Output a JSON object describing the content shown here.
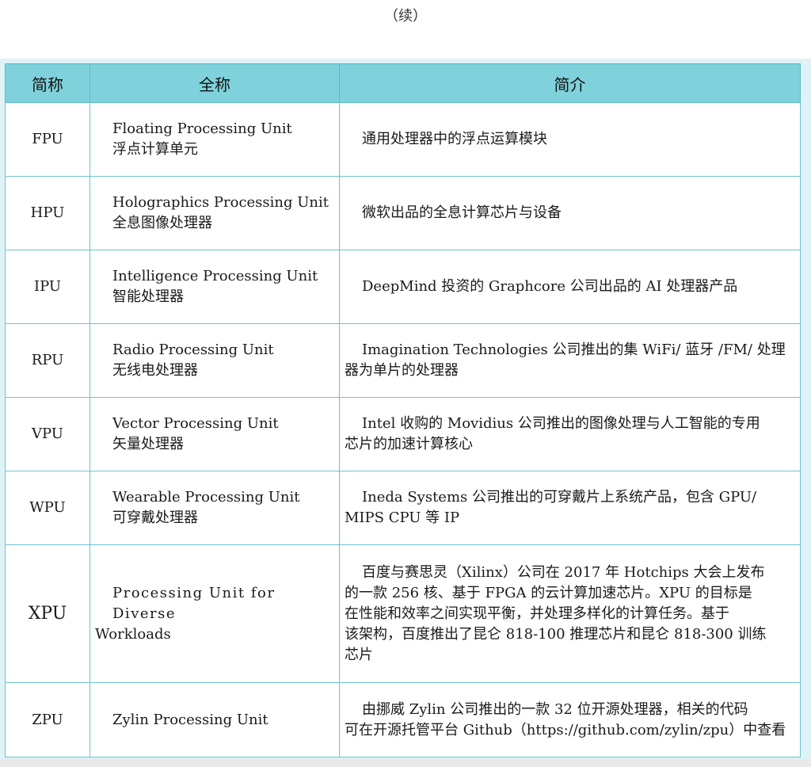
{
  "caption": "（续）",
  "table": {
    "headers": [
      "简称",
      "全称",
      "简介"
    ],
    "rows": [
      {
        "abbr": "FPU",
        "full_en": "Floating Processing Unit",
        "full_cn": "浮点计算单元",
        "desc": "通用处理器中的浮点运算模块"
      },
      {
        "abbr": "HPU",
        "full_en": "Holographics Processing Unit",
        "full_cn": "全息图像处理器",
        "desc": "微软出品的全息计算芯片与设备"
      },
      {
        "abbr": "IPU",
        "full_en": "Intelligence Processing Unit",
        "full_cn": "智能处理器",
        "desc": "DeepMind 投资的 Graphcore 公司出品的 AI 处理器产品"
      },
      {
        "abbr": "RPU",
        "full_en": "Radio Processing Unit",
        "full_cn": "无线电处理器",
        "desc_line1": "Imagination Technologies 公司推出的集 WiFi/ 蓝牙 /FM/ 处理",
        "desc_line2": "器为单片的处理器"
      },
      {
        "abbr": "VPU",
        "full_en": "Vector Processing Unit",
        "full_cn": "矢量处理器",
        "desc_line1": "Intel 收购的 Movidius 公司推出的图像处理与人工智能的专用",
        "desc_line2": "芯片的加速计算核心"
      },
      {
        "abbr": "WPU",
        "full_en": "Wearable Processing Unit",
        "full_cn": "可穿戴处理器",
        "desc_line1": "Ineda Systems 公司推出的可穿戴片上系统产品，包含 GPU/",
        "desc_line2": "MIPS CPU 等 IP"
      },
      {
        "abbr": "XPU",
        "full_en_line1": "Processing Unit for Diverse",
        "full_en_line2": "Workloads",
        "desc_line1": "百度与赛思灵（Xilinx）公司在 2017 年 Hotchips 大会上发布",
        "desc_line2": "的一款 256 核、基于 FPGA 的云计算加速芯片。XPU 的目标是",
        "desc_line3": "在性能和效率之间实现平衡，并处理多样化的计算任务。基于",
        "desc_line4": "该架构，百度推出了昆仑 818-100 推理芯片和昆仑 818-300 训练",
        "desc_line5": "芯片"
      },
      {
        "abbr": "ZPU",
        "full_en": "Zylin Processing Unit",
        "desc_line1": "由挪威 Zylin 公司推出的一款 32 位开源处理器，相关的代码",
        "desc_line2": "可在开源托管平台 Github（https://github.com/zylin/zpu）中查看"
      }
    ]
  }
}
